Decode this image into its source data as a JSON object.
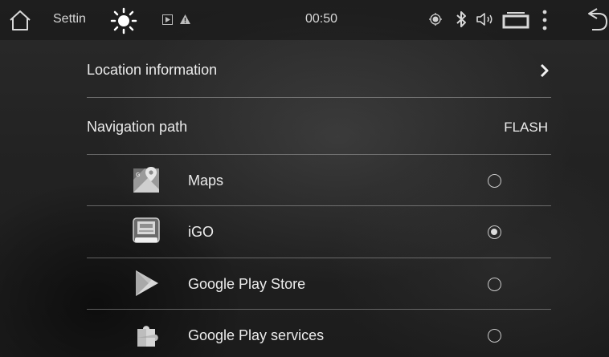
{
  "status_bar": {
    "title": "Settin",
    "time": "00:50",
    "icons": {
      "home": "home-icon",
      "brightness": "brightness-icon",
      "media": "media-icon",
      "warning": "warning-icon",
      "gps": "gps-icon",
      "bluetooth": "bluetooth-icon",
      "volume": "volume-icon",
      "recent_apps": "recent-apps-icon",
      "menu": "menu-dots-icon",
      "back": "back-icon"
    }
  },
  "settings": {
    "location_information": {
      "label": "Location information",
      "icon": "chevron-right-icon"
    },
    "navigation_path": {
      "label": "Navigation path",
      "value": "FLASH"
    }
  },
  "apps": [
    {
      "label": "Maps",
      "icon": "maps-app-icon",
      "selected": false
    },
    {
      "label": "iGO",
      "icon": "igo-app-icon",
      "selected": true
    },
    {
      "label": "Google Play Store",
      "icon": "play-store-app-icon",
      "selected": false
    },
    {
      "label": "Google Play services",
      "icon": "play-services-app-icon",
      "selected": false
    }
  ]
}
